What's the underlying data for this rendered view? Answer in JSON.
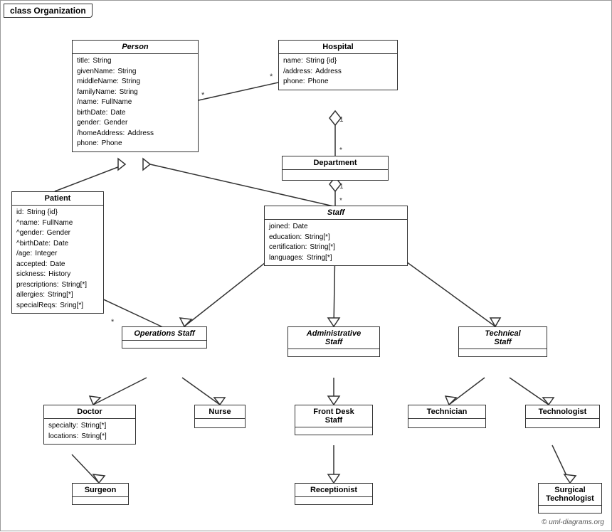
{
  "title": "class Organization",
  "classes": {
    "person": {
      "name": "Person",
      "italic": true,
      "attrs": [
        {
          "name": "title:",
          "type": "String"
        },
        {
          "name": "givenName:",
          "type": "String"
        },
        {
          "name": "middleName:",
          "type": "String"
        },
        {
          "name": "familyName:",
          "type": "String"
        },
        {
          "name": "/name:",
          "type": "FullName"
        },
        {
          "name": "birthDate:",
          "type": "Date"
        },
        {
          "name": "gender:",
          "type": "Gender"
        },
        {
          "name": "/homeAddress:",
          "type": "Address"
        },
        {
          "name": "phone:",
          "type": "Phone"
        }
      ]
    },
    "hospital": {
      "name": "Hospital",
      "italic": false,
      "attrs": [
        {
          "name": "name:",
          "type": "String {id}"
        },
        {
          "name": "/address:",
          "type": "Address"
        },
        {
          "name": "phone:",
          "type": "Phone"
        }
      ]
    },
    "patient": {
      "name": "Patient",
      "italic": false,
      "attrs": [
        {
          "name": "id:",
          "type": "String {id}"
        },
        {
          "name": "^name:",
          "type": "FullName"
        },
        {
          "name": "^gender:",
          "type": "Gender"
        },
        {
          "name": "^birthDate:",
          "type": "Date"
        },
        {
          "name": "/age:",
          "type": "Integer"
        },
        {
          "name": "accepted:",
          "type": "Date"
        },
        {
          "name": "sickness:",
          "type": "History"
        },
        {
          "name": "prescriptions:",
          "type": "String[*]"
        },
        {
          "name": "allergies:",
          "type": "String[*]"
        },
        {
          "name": "specialReqs:",
          "type": "Sring[*]"
        }
      ]
    },
    "department": {
      "name": "Department",
      "italic": false,
      "attrs": []
    },
    "staff": {
      "name": "Staff",
      "italic": true,
      "attrs": [
        {
          "name": "joined:",
          "type": "Date"
        },
        {
          "name": "education:",
          "type": "String[*]"
        },
        {
          "name": "certification:",
          "type": "String[*]"
        },
        {
          "name": "languages:",
          "type": "String[*]"
        }
      ]
    },
    "operations_staff": {
      "name": "Operations Staff",
      "italic": true,
      "attrs": []
    },
    "administrative_staff": {
      "name": "Administrative Staff",
      "italic": true,
      "attrs": []
    },
    "technical_staff": {
      "name": "Technical Staff",
      "italic": true,
      "attrs": []
    },
    "doctor": {
      "name": "Doctor",
      "italic": false,
      "attrs": [
        {
          "name": "specialty:",
          "type": "String[*]"
        },
        {
          "name": "locations:",
          "type": "String[*]"
        }
      ]
    },
    "nurse": {
      "name": "Nurse",
      "italic": false,
      "attrs": []
    },
    "front_desk_staff": {
      "name": "Front Desk Staff",
      "italic": false,
      "attrs": []
    },
    "technician": {
      "name": "Technician",
      "italic": false,
      "attrs": []
    },
    "technologist": {
      "name": "Technologist",
      "italic": false,
      "attrs": []
    },
    "surgeon": {
      "name": "Surgeon",
      "italic": false,
      "attrs": []
    },
    "receptionist": {
      "name": "Receptionist",
      "italic": false,
      "attrs": []
    },
    "surgical_technologist": {
      "name": "Surgical Technologist",
      "italic": false,
      "attrs": []
    }
  },
  "copyright": "© uml-diagrams.org"
}
